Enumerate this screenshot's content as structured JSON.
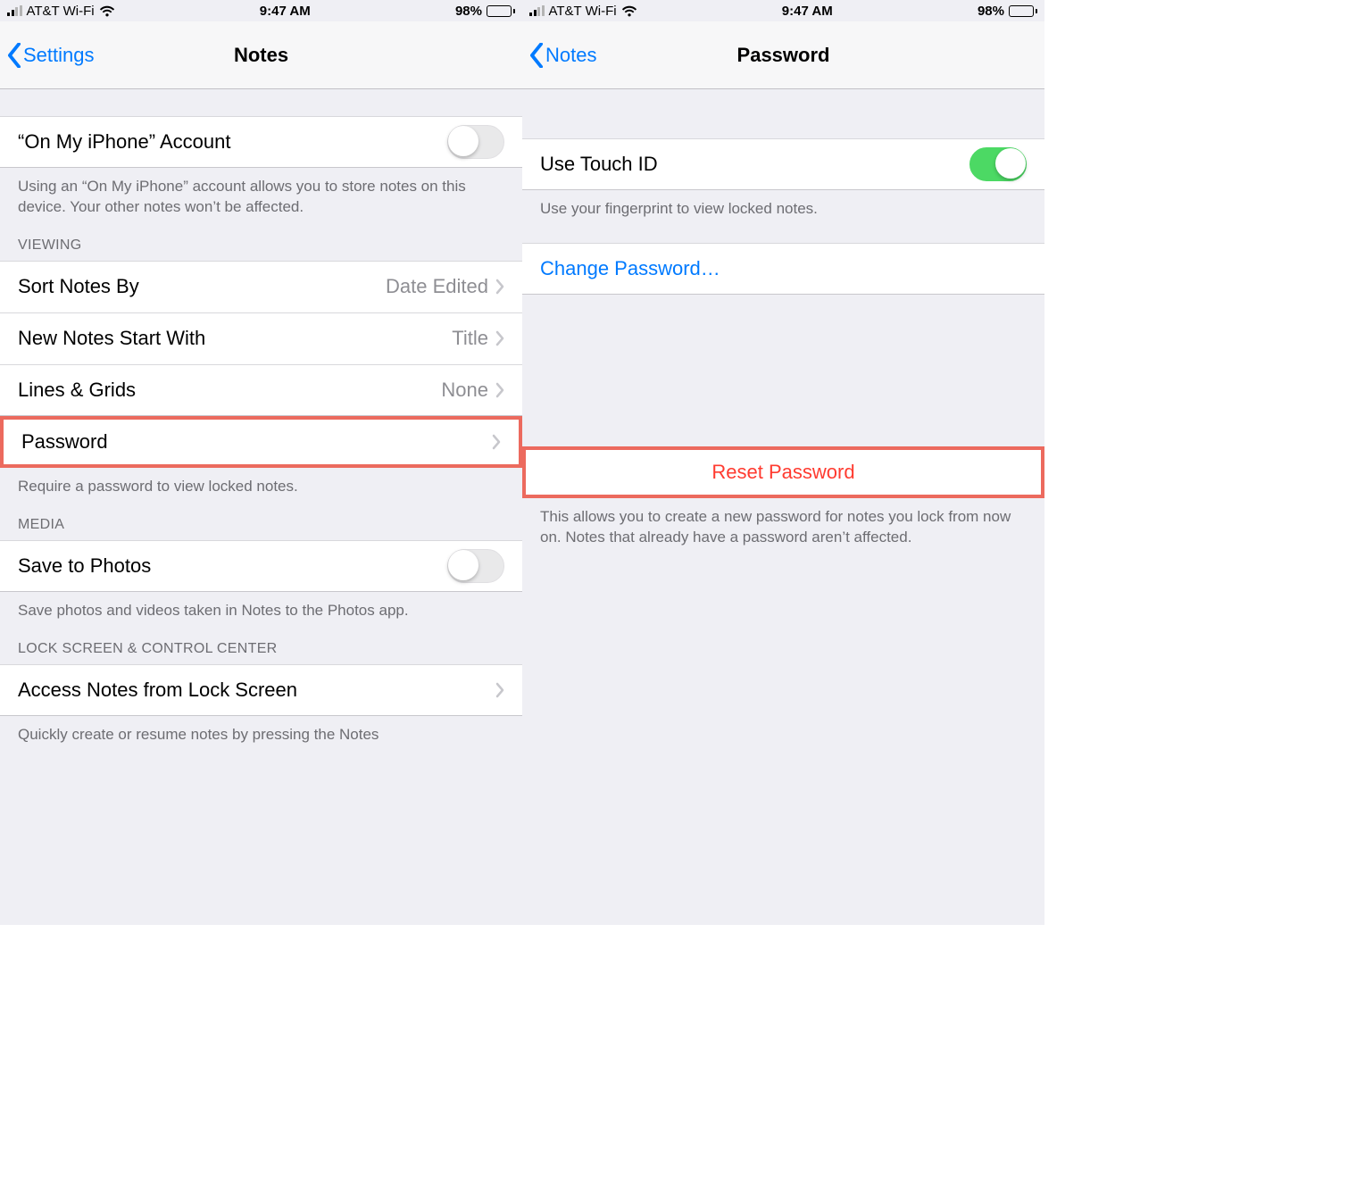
{
  "left": {
    "status": {
      "carrier": "AT&T Wi-Fi",
      "time": "9:47 AM",
      "battery": "98%"
    },
    "nav": {
      "back": "Settings",
      "title": "Notes"
    },
    "on_my_iphone": {
      "label": "“On My iPhone” Account",
      "footer": "Using an “On My iPhone” account allows you to store notes on this device. Your other notes won’t be affected."
    },
    "viewing": {
      "header": "VIEWING",
      "sort": {
        "label": "Sort Notes By",
        "value": "Date Edited"
      },
      "start": {
        "label": "New Notes Start With",
        "value": "Title"
      },
      "lines": {
        "label": "Lines & Grids",
        "value": "None"
      },
      "password": {
        "label": "Password"
      },
      "password_footer": "Require a password to view locked notes."
    },
    "media": {
      "header": "MEDIA",
      "save": {
        "label": "Save to Photos"
      },
      "footer": "Save photos and videos taken in Notes to the Photos app."
    },
    "lock": {
      "header": "LOCK SCREEN & CONTROL CENTER",
      "access": {
        "label": "Access Notes from Lock Screen"
      },
      "footer": "Quickly create or resume notes by pressing the Notes"
    }
  },
  "right": {
    "status": {
      "carrier": "AT&T Wi-Fi",
      "time": "9:47 AM",
      "battery": "98%"
    },
    "nav": {
      "back": "Notes",
      "title": "Password"
    },
    "touchid": {
      "label": "Use Touch ID",
      "footer": "Use your fingerprint to view locked notes."
    },
    "change": {
      "label": "Change Password…"
    },
    "reset": {
      "label": "Reset Password",
      "footer": "This allows you to create a new password for notes you lock from now on. Notes that already have a password aren’t affected."
    }
  }
}
